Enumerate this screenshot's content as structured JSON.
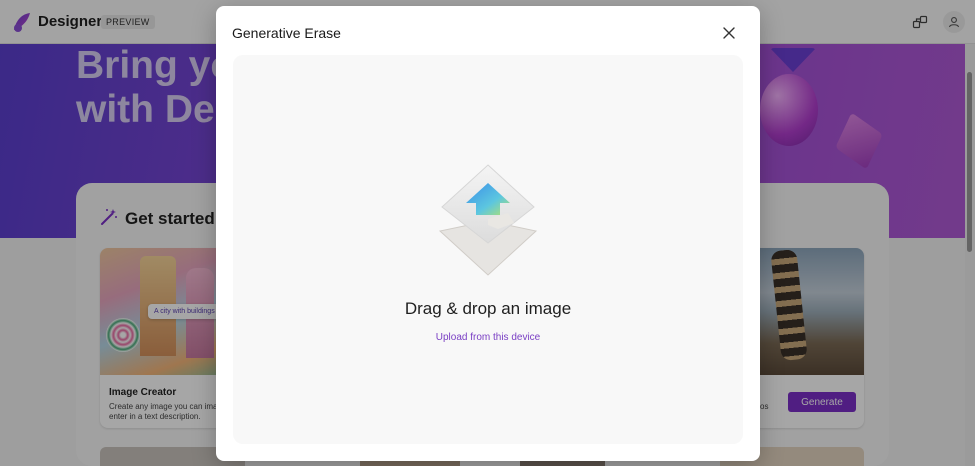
{
  "header": {
    "brand": "Designer",
    "badge": "PREVIEW"
  },
  "hero": {
    "line1": "Bring yo",
    "line2": "with Des"
  },
  "get_started": {
    "title": "Get started"
  },
  "tiles": [
    {
      "caption_chip": "A city with buildings",
      "title": "Image Creator",
      "description": "Create any image you can ima enter in a text description."
    },
    {
      "description_fragment": "os",
      "button_label": "Generate"
    }
  ],
  "modal": {
    "title": "Generative Erase",
    "drop_label": "Drag & drop an image",
    "upload_link": "Upload from this device"
  },
  "colors": {
    "accent": "#7b2fc8",
    "link": "#7a3fc4",
    "hero_gradient_start": "#5b3fd0",
    "hero_gradient_end": "#b05ad6"
  },
  "icons": {
    "logo": "designer-logo-icon",
    "share": "share-icon",
    "user": "user-icon",
    "get_started": "magic-wand-icon",
    "close": "close-icon",
    "upload": "upload-arrow-icon"
  }
}
